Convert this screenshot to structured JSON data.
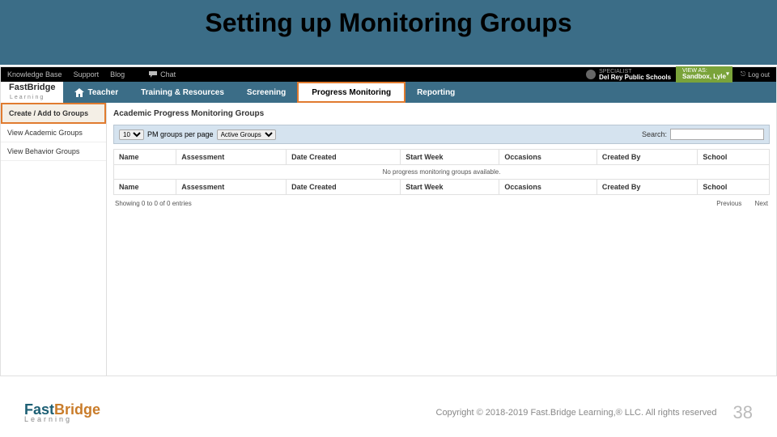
{
  "slide": {
    "title": "Setting up Monitoring Groups",
    "page": "38",
    "copyright": "Copyright © 2018-2019 Fast.Bridge Learning,® LLC. All rights reserved"
  },
  "footer_logo": {
    "fast": "Fast",
    "bridge": "Bridge",
    "sub": "Learning"
  },
  "topbar": {
    "kb": "Knowledge Base",
    "support": "Support",
    "blog": "Blog",
    "chat": "Chat",
    "spec_label": "SPECIALIST",
    "spec_org": "Del Rey Public Schools",
    "viewas_label": "VIEW AS:",
    "viewas_value": "Sandbox, Lyle",
    "logout": "Log out"
  },
  "brand": {
    "main": "FastBridge",
    "sub": "Learning"
  },
  "nav": {
    "teacher": "Teacher",
    "training": "Training & Resources",
    "screening": "Screening",
    "progress": "Progress Monitoring",
    "reporting": "Reporting"
  },
  "sidebar": {
    "create": "Create / Add to Groups",
    "academic": "View Academic Groups",
    "behavior": "View Behavior Groups"
  },
  "content": {
    "heading": "Academic Progress Monitoring Groups",
    "perpage_value": "10",
    "perpage_label": "PM groups per page",
    "filter_value": "Active Groups",
    "search_label": "Search:",
    "cols": {
      "name": "Name",
      "assessment": "Assessment",
      "date_created": "Date Created",
      "start_week": "Start Week",
      "occasions": "Occasions",
      "created_by": "Created By",
      "school": "School"
    },
    "empty": "No progress monitoring groups available.",
    "showing": "Showing 0 to 0 of 0 entries",
    "prev": "Previous",
    "next": "Next"
  }
}
